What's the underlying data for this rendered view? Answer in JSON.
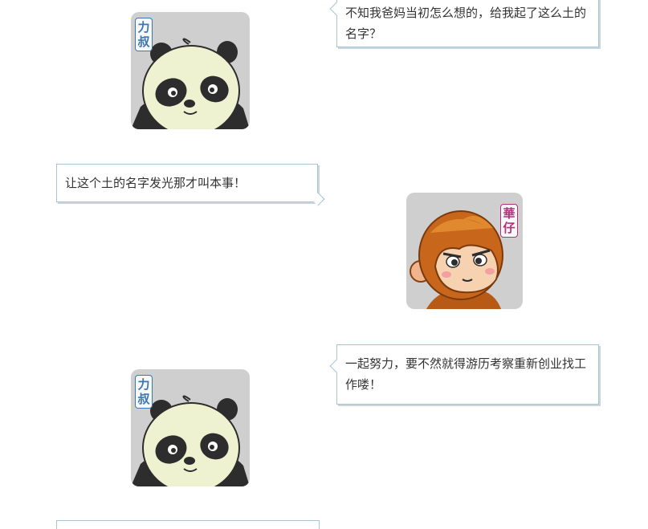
{
  "messages": [
    {
      "speaker": "panda",
      "text": "不知我爸妈当初怎么想的，给我起了这么土的名字？"
    },
    {
      "speaker": "panda",
      "text": "让这个土的名字发光那才叫本事！"
    },
    {
      "speaker": "monkey",
      "text": "一起努力，要不然就得游历考察重新创业找工作喽！"
    }
  ],
  "avatars": {
    "panda": {
      "tag_chars": [
        "力",
        "叔"
      ],
      "tag_color": "#3b77b5"
    },
    "monkey": {
      "tag_chars": [
        "華",
        "仔"
      ],
      "tag_color": "#b0307c"
    }
  }
}
